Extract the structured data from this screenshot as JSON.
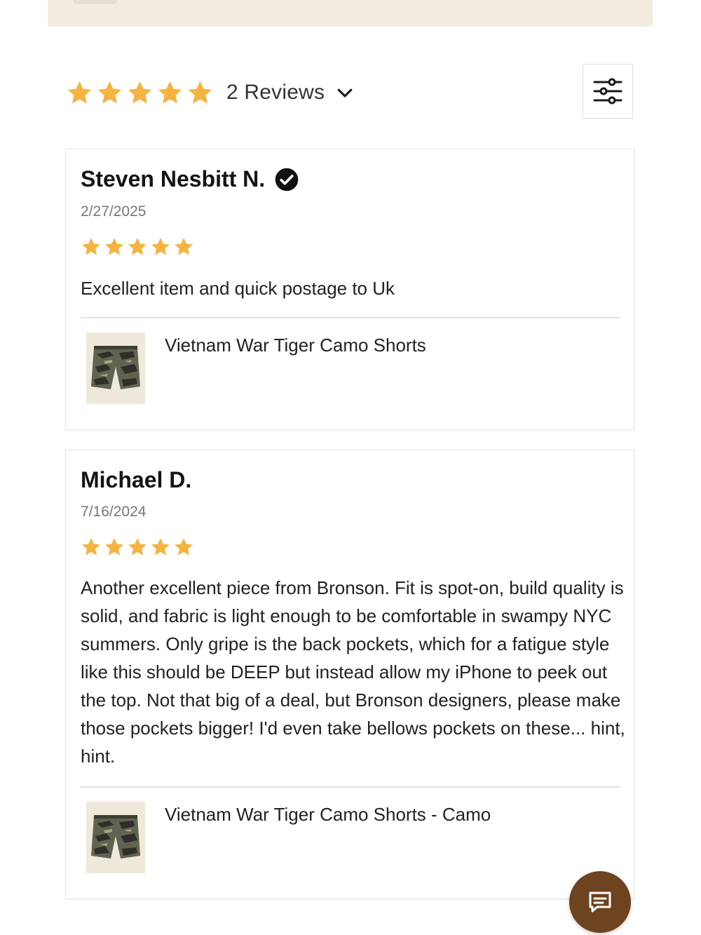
{
  "summary": {
    "rating": 5,
    "max_rating": 5,
    "count_label": "2 Reviews"
  },
  "reviews": [
    {
      "name": "Steven Nesbitt N.",
      "verified": true,
      "date": "2/27/2025",
      "rating": 5,
      "text": "Excellent item and quick postage to Uk",
      "product": "Vietnam War Tiger Camo Shorts"
    },
    {
      "name": "Michael D.",
      "verified": false,
      "date": "7/16/2024",
      "rating": 5,
      "text": "Another excellent piece from Bronson. Fit is spot-on, build quality is solid, and fabric is light enough to be comfortable in swampy NYC summers. Only gripe is the back pockets, which for a fatigue style like this should be DEEP but instead allow my iPhone to peek out the top. Not that big of a deal, but Bronson designers, please make those pockets bigger! I'd even take bellows pockets on these... hint, hint.",
      "product": "Vietnam War Tiger Camo Shorts - Camo"
    }
  ],
  "colors": {
    "star": "#f5b342",
    "chat_button": "#6e4320",
    "banner": "#f3ece0"
  },
  "icons": [
    "star-icon",
    "chevron-down-icon",
    "filter-sliders-icon",
    "verified-check-icon",
    "chat-icon"
  ]
}
